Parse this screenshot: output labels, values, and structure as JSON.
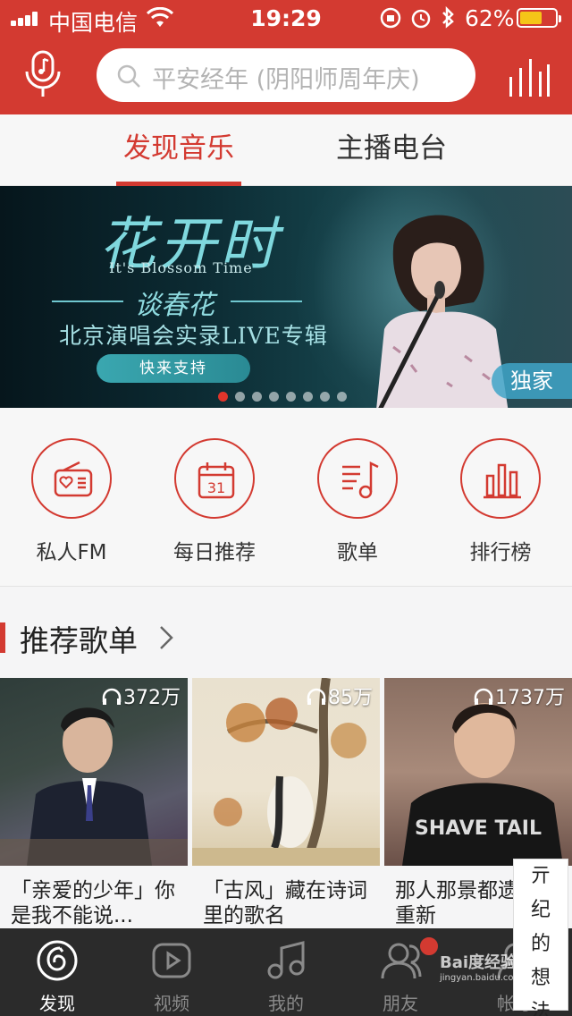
{
  "status_bar": {
    "carrier": "中国电信",
    "time": "19:29",
    "battery_percent": "62%",
    "battery_level": 0.62
  },
  "header": {
    "search_placeholder": "平安经年 (阴阳师周年庆)",
    "mic_icon": "mic-note-icon",
    "bars_icon": "equalizer-icon"
  },
  "tabs": [
    {
      "label": "发现音乐",
      "active": true
    },
    {
      "label": "主播电台",
      "active": false
    }
  ],
  "banner": {
    "title": "花开时",
    "subtitle_en": "It's Blossom Time",
    "artist": "谈春花",
    "concert": "北京演唱会实录LIVE专辑",
    "button": "快来支持",
    "badge": "独家",
    "dot_count": 8,
    "active_dot": 0
  },
  "quick_entries": [
    {
      "label": "私人FM",
      "icon": "radio-heart-icon"
    },
    {
      "label": "每日推荐",
      "icon": "calendar-icon",
      "icon_text": "31"
    },
    {
      "label": "歌单",
      "icon": "playlist-note-icon"
    },
    {
      "label": "排行榜",
      "icon": "ranking-bars-icon"
    }
  ],
  "section": {
    "title": "推荐歌单"
  },
  "playlists": [
    {
      "count": "372万",
      "name": "「亲爱的少年」你是我不能说..."
    },
    {
      "count": "85万",
      "name": "「古风」藏在诗词里的歌名"
    },
    {
      "count": "1737万",
      "name": "那人那景都遗忘中重新"
    }
  ],
  "bottom_nav": [
    {
      "label": "发现",
      "icon": "netease-logo-icon",
      "active": true
    },
    {
      "label": "视频",
      "icon": "video-play-icon",
      "active": false
    },
    {
      "label": "我的",
      "icon": "music-note-icon",
      "active": false
    },
    {
      "label": "朋友",
      "icon": "friends-icon",
      "active": false
    },
    {
      "label": "帐号",
      "icon": "account-icon",
      "active": false
    }
  ],
  "watermark": {
    "chars": [
      "亓",
      "纪",
      "的",
      "想",
      "法"
    ],
    "brand": "Bai度经验",
    "url": "jingyan.baidu.com"
  },
  "colors": {
    "brand_red": "#d33a31",
    "nav_bg": "#2b2b2b",
    "page_bg": "#f7f7f7"
  }
}
